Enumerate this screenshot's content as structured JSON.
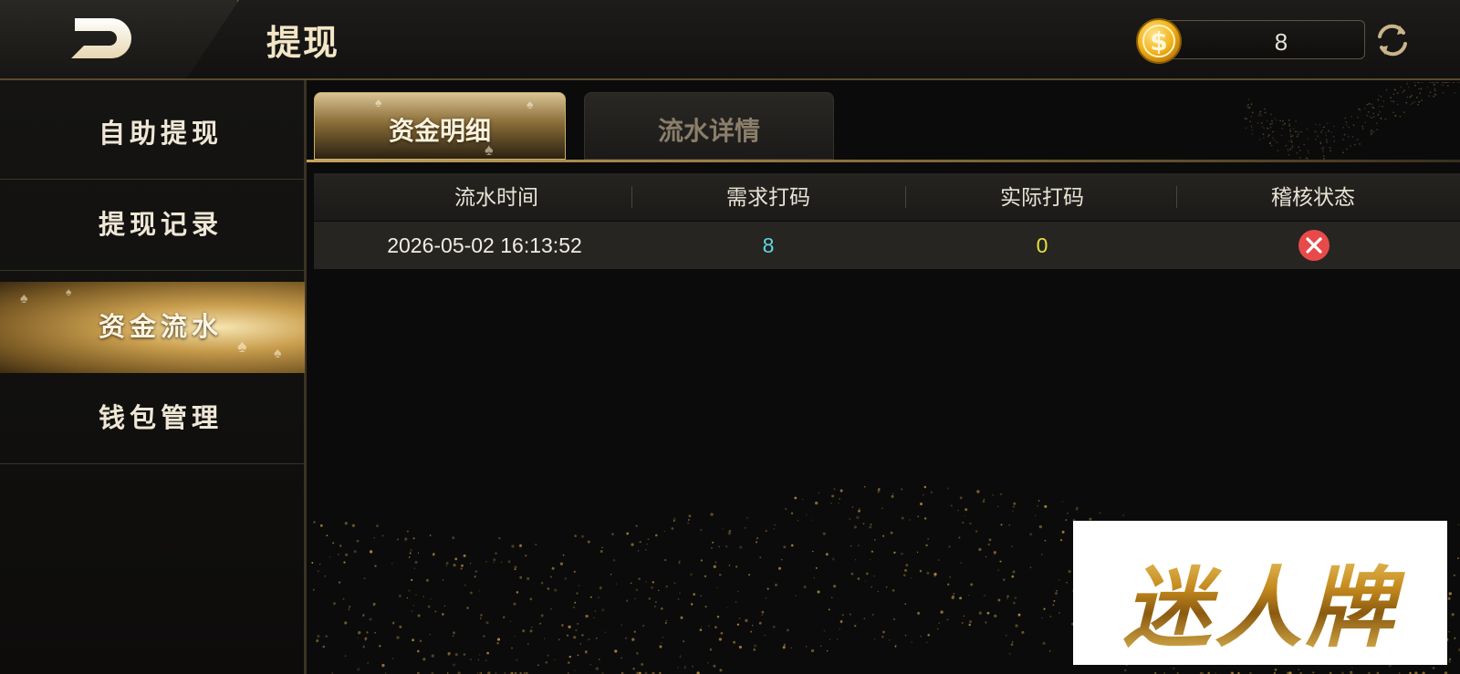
{
  "header": {
    "title": "提现",
    "balance": "8"
  },
  "sidebar": {
    "items": [
      {
        "label": "自助提现",
        "active": false
      },
      {
        "label": "提现记录",
        "active": false
      },
      {
        "label": "资金流水",
        "active": true
      },
      {
        "label": "钱包管理",
        "active": false
      }
    ]
  },
  "tabs": [
    {
      "label": "资金明细",
      "active": true
    },
    {
      "label": "流水详情",
      "active": false
    }
  ],
  "table": {
    "columns": [
      "流水时间",
      "需求打码",
      "实际打码",
      "稽核状态"
    ],
    "rows": [
      {
        "time": "2026-05-02 16:13:52",
        "required": "8",
        "actual": "0",
        "status": "failed"
      }
    ]
  },
  "colors": {
    "accent_gold": "#c9a25c",
    "required_value": "#5fd7e3",
    "actual_value": "#e6e03a",
    "status_fail": "#e84a4a"
  },
  "icons": {
    "back": "back-arrow-icon",
    "coin": "dollar-coin-icon",
    "refresh": "refresh-icon",
    "status": "close-circle-icon"
  },
  "watermark": {
    "text": "迷人牌"
  }
}
